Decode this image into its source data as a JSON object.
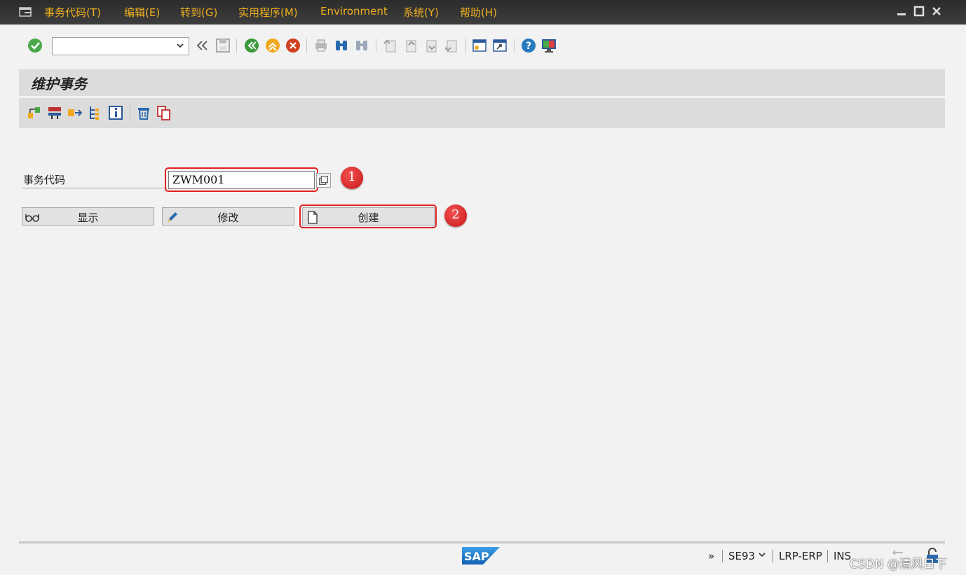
{
  "menu": {
    "items": [
      "事务代码(T)",
      "编辑(E)",
      "转到(G)",
      "实用程序(M)",
      "Environment",
      "系统(Y)",
      "帮助(H)"
    ]
  },
  "toolbar": {
    "command_field_value": "",
    "icons": [
      "enter-icon",
      "back-double-icon",
      "save-icon",
      "back-icon",
      "exit-icon",
      "cancel-icon",
      "print-icon",
      "find-icon",
      "find-next-icon",
      "first-page-icon",
      "prev-page-icon",
      "next-page-icon",
      "last-page-icon",
      "new-session-icon",
      "shortcut-icon",
      "help-icon",
      "customize-layout-icon"
    ]
  },
  "title": "维护事务",
  "app_toolbar": {
    "icons": [
      "object-list-icon",
      "tcode-hierarchy-icon",
      "where-used-icon",
      "object-directory-icon",
      "info-icon",
      "delete-icon",
      "copy-icon"
    ]
  },
  "form": {
    "field_label": "事务代码",
    "field_value": "ZWM001"
  },
  "buttons": {
    "display": "显示",
    "change": "修改",
    "create": "创建"
  },
  "annotations": {
    "badge1": "1",
    "badge2": "2"
  },
  "status": {
    "more": "»",
    "tcode": "SE93",
    "system": "LRP-ERP",
    "mode": "INS"
  },
  "watermark": "CSDN @清风日下",
  "colors": {
    "menubar": "#333333",
    "menu_text": "#f0b020",
    "highlight": "#e02020"
  }
}
